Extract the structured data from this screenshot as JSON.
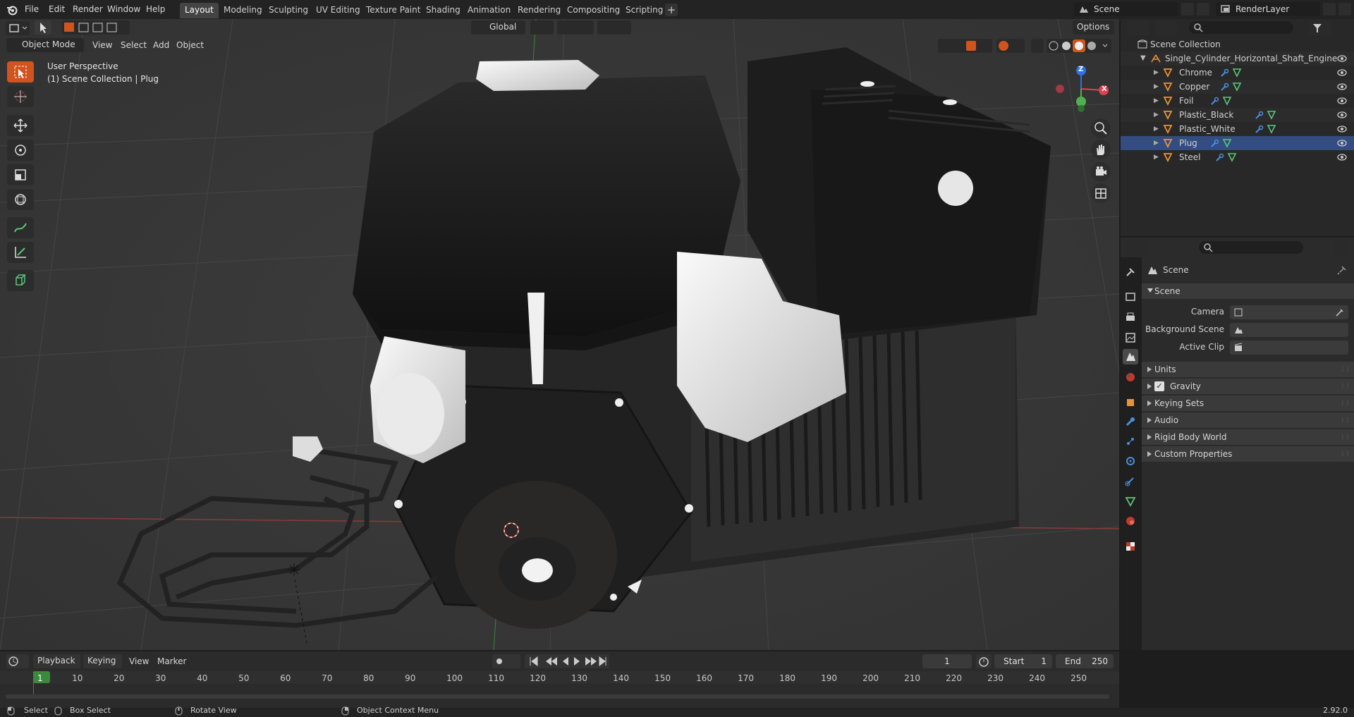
{
  "topbar": {
    "menus": [
      "File",
      "Edit",
      "Render",
      "Window",
      "Help"
    ],
    "workspaces": [
      "Layout",
      "Modeling",
      "Sculpting",
      "UV Editing",
      "Texture Paint",
      "Shading",
      "Animation",
      "Rendering",
      "Compositing",
      "Scripting"
    ],
    "active_workspace": "Layout",
    "add_tab": "+",
    "scene_name": "Scene",
    "view_layer": "RenderLayer"
  },
  "viewport_header": {
    "mode": "Object Mode",
    "menus": [
      "View",
      "Select",
      "Add",
      "Object"
    ],
    "transform_orientation": "Global",
    "options": "Options"
  },
  "viewport_info": {
    "line1": "User Perspective",
    "line2": "(1) Scene Collection | Plug"
  },
  "gizmo": {
    "z": "Z",
    "x": "X",
    "y": "Y"
  },
  "outliner": {
    "root": "Scene Collection",
    "collection": "Single_Cylinder_Horizontal_Shaft_Engine",
    "items": [
      "Chrome",
      "Copper",
      "Foil",
      "Plastic_Black",
      "Plastic_White",
      "Plug",
      "Steel"
    ],
    "selected": "Plug"
  },
  "properties": {
    "context": "Scene",
    "panel": "Scene",
    "fields": [
      {
        "label": "Camera",
        "value": ""
      },
      {
        "label": "Background Scene",
        "value": ""
      },
      {
        "label": "Active Clip",
        "value": ""
      }
    ],
    "subpanels": [
      "Units",
      "Gravity",
      "Keying Sets",
      "Audio",
      "Rigid Body World",
      "Custom Properties"
    ],
    "gravity_checked": true
  },
  "timeline": {
    "menus": [
      "Playback",
      "Keying",
      "View",
      "Marker"
    ],
    "current_frame": "1",
    "start_label": "Start",
    "start": "1",
    "end_label": "End",
    "end": "250",
    "ruler": [
      "1",
      "10",
      "20",
      "30",
      "40",
      "50",
      "60",
      "70",
      "80",
      "90",
      "100",
      "110",
      "120",
      "130",
      "140",
      "150",
      "160",
      "170",
      "180",
      "190",
      "200",
      "210",
      "220",
      "230",
      "240",
      "250"
    ]
  },
  "statusbar": {
    "select": "Select",
    "box_select": "Box Select",
    "rotate": "Rotate View",
    "context_menu": "Object Context Menu",
    "version": "2.92.0"
  },
  "colors": {
    "accent_orange": "#d1541f",
    "selection_blue": "#334d80",
    "axis_x": "#e04050",
    "axis_y": "#50b050",
    "axis_z": "#3070e0",
    "frame_green": "#3b8a3b"
  }
}
